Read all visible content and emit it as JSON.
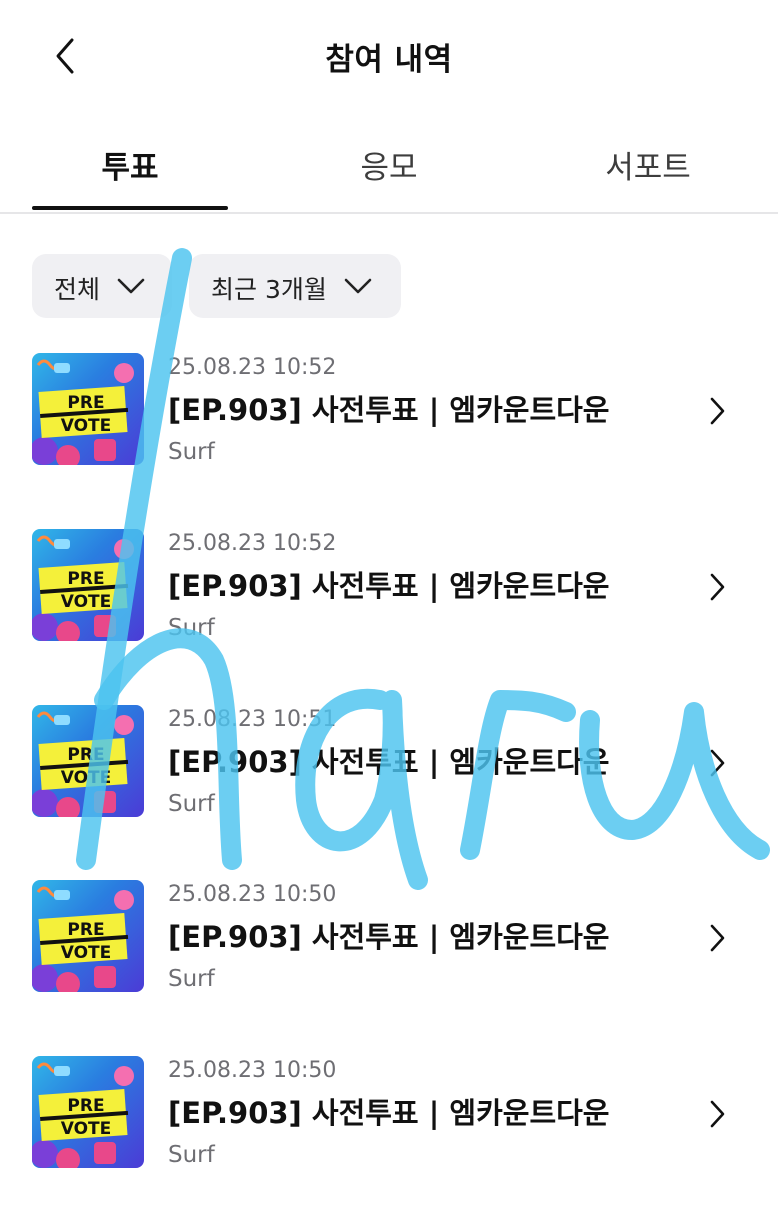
{
  "header": {
    "title": "참여 내역",
    "back_icon": "chevron-left-icon"
  },
  "tabs": [
    {
      "label": "투표",
      "active": true
    },
    {
      "label": "응모",
      "active": false
    },
    {
      "label": "서포트",
      "active": false
    }
  ],
  "filters": {
    "category": {
      "label": "전체",
      "icon": "chevron-down-icon"
    },
    "period": {
      "label": "최근 3개월",
      "icon": "chevron-down-icon"
    }
  },
  "items": [
    {
      "date": "25.08.23 10:52",
      "title": "[EP.903] 사전투표 | 엠카운트다운",
      "sub": "Surf",
      "thumb_text": [
        "PRE",
        "VOTE"
      ]
    },
    {
      "date": "25.08.23 10:52",
      "title": "[EP.903] 사전투표 | 엠카운트다운",
      "sub": "Surf",
      "thumb_text": [
        "PRE",
        "VOTE"
      ]
    },
    {
      "date": "25.08.23 10:51",
      "title": "[EP.903] 사전투표 | 엠카운트다운",
      "sub": "Surf",
      "thumb_text": [
        "PRE",
        "VOTE"
      ]
    },
    {
      "date": "25.08.23 10:50",
      "title": "[EP.903] 사전투표 | 엠카운트다운",
      "sub": "Surf",
      "thumb_text": [
        "PRE",
        "VOTE"
      ]
    },
    {
      "date": "25.08.23 10:50",
      "title": "[EP.903] 사전투표 | 엠카운트다운",
      "sub": "Surf",
      "thumb_text": [
        "PRE",
        "VOTE"
      ]
    }
  ],
  "colors": {
    "accent_underline": "#111111",
    "filter_bg": "#f0f0f3",
    "watermark": "#4cc3ef",
    "pre_vote_badge": "#f4f03a"
  }
}
